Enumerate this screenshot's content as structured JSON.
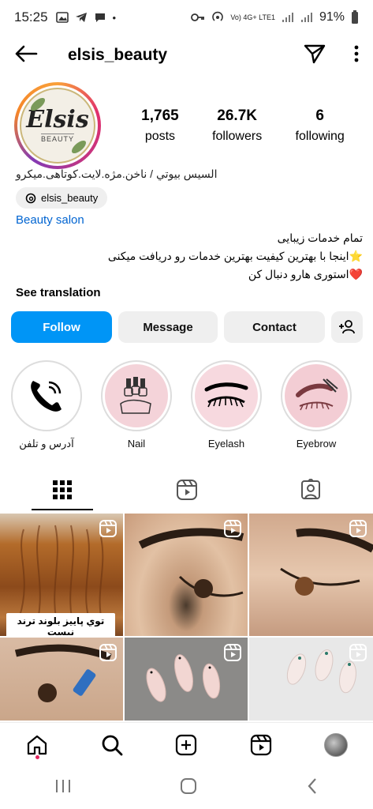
{
  "status_bar": {
    "time": "15:25",
    "network_label": "Vo) 4G+ LTE1",
    "battery": "91%"
  },
  "header": {
    "username": "elsis_beauty",
    "icons": [
      "back-arrow-icon",
      "send-icon",
      "more-vertical-icon"
    ]
  },
  "profile": {
    "avatar_logo_text": "Elsis",
    "avatar_logo_sub": "BEAUTY",
    "stats": [
      {
        "value": "1,765",
        "label": "posts"
      },
      {
        "value": "26.7K",
        "label": "followers"
      },
      {
        "value": "6",
        "label": "following"
      }
    ],
    "name_line": "السیس بیوتي / ناخن.مژه.لایت.کوتاهی.میکرو",
    "threads_handle": "elsis_beauty",
    "category": "Beauty salon",
    "bio_lines": [
      "تمام خدمات زیبایی",
      "⭐اینجا با بهترین کیفیت بهترین خدمات رو دریافت میکنی",
      "❤️استوری هارو دنبال کن"
    ],
    "see_translation": "See translation"
  },
  "buttons": {
    "follow": "Follow",
    "message": "Message",
    "contact": "Contact"
  },
  "highlights": [
    {
      "label": "آدرس و تلفن",
      "icon": "phone-icon"
    },
    {
      "label": "Nail",
      "icon": "nail-polish-icon"
    },
    {
      "label": "Eyelash",
      "icon": "eyelash-icon"
    },
    {
      "label": "Eyebrow",
      "icon": "eyebrow-icon"
    }
  ],
  "tabs": [
    "grid-icon",
    "reels-icon",
    "tagged-icon"
  ],
  "grid": {
    "first_post_caption": "توي پاييز بلوند ترند نيست"
  },
  "colors": {
    "follow_blue": "#0095f6",
    "link_blue": "#0064d1",
    "button_gray": "#efefef"
  }
}
